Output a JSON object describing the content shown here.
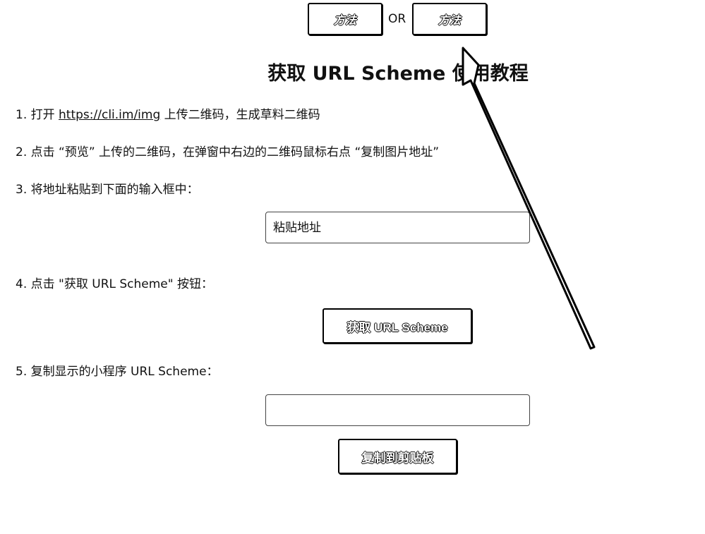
{
  "header": {
    "method_button_1": "方法",
    "or_label": "OR",
    "method_button_2": "方法"
  },
  "title": "获取 URL Scheme 使用教程",
  "steps": {
    "step1_prefix": "1. 打开 ",
    "step1_link": "https://cli.im/img",
    "step1_suffix": " 上传二维码，生成草料二维码",
    "step2": "2. 点击 “预览” 上传的二维码，在弹窗中右边的二维码鼠标右点 “复制图片地址”",
    "step3": "3. 将地址粘贴到下面的输入框中：",
    "step4": "4. 点击 \"获取 URL Scheme\" 按钮：",
    "step5": "5. 复制显示的小程序 URL Scheme："
  },
  "url_input": {
    "placeholder": "粘贴地址",
    "value": ""
  },
  "get_scheme_button": "获取 URL Scheme",
  "scheme_output": {
    "value": ""
  },
  "copy_button": "复制到剪贴板",
  "icons": {
    "annotation_arrow": "arrow-up-left-icon"
  }
}
